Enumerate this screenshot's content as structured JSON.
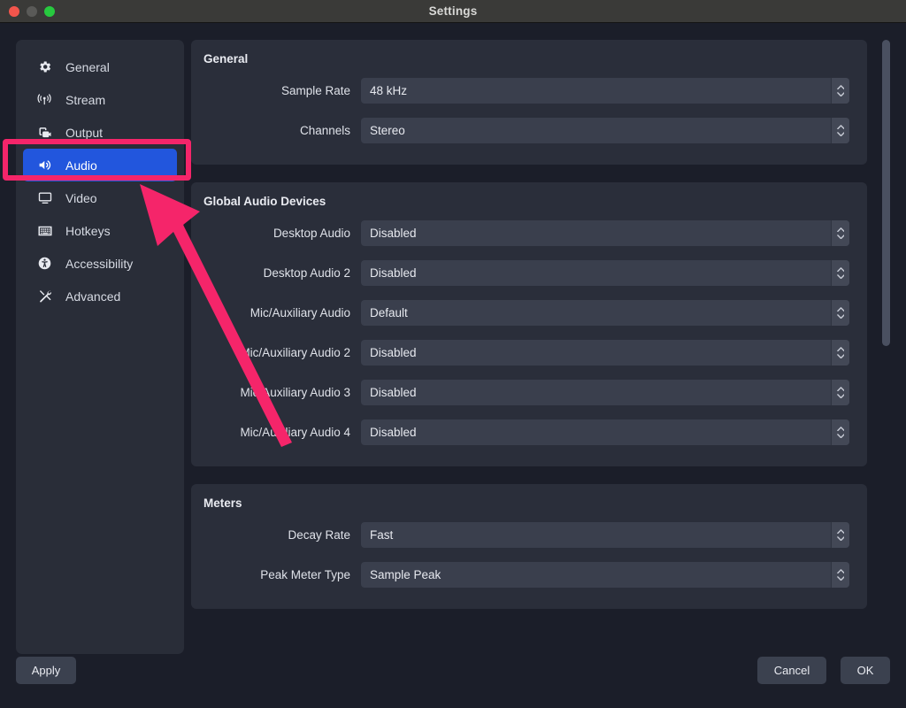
{
  "window": {
    "title": "Settings",
    "traffic_lights": [
      "close",
      "minimize",
      "maximize"
    ]
  },
  "sidebar": {
    "items": [
      {
        "label": "General",
        "icon": "gear-icon",
        "active": false
      },
      {
        "label": "Stream",
        "icon": "broadcast-icon",
        "active": false
      },
      {
        "label": "Output",
        "icon": "video-output-icon",
        "active": false
      },
      {
        "label": "Audio",
        "icon": "speaker-icon",
        "active": true
      },
      {
        "label": "Video",
        "icon": "monitor-icon",
        "active": false
      },
      {
        "label": "Hotkeys",
        "icon": "keyboard-icon",
        "active": false
      },
      {
        "label": "Accessibility",
        "icon": "accessibility-icon",
        "active": false
      },
      {
        "label": "Advanced",
        "icon": "tools-icon",
        "active": false
      }
    ]
  },
  "main": {
    "groups": [
      {
        "title": "General",
        "rows": [
          {
            "label": "Sample Rate",
            "value": "48 kHz"
          },
          {
            "label": "Channels",
            "value": "Stereo"
          }
        ]
      },
      {
        "title": "Global Audio Devices",
        "rows": [
          {
            "label": "Desktop Audio",
            "value": "Disabled"
          },
          {
            "label": "Desktop Audio 2",
            "value": "Disabled"
          },
          {
            "label": "Mic/Auxiliary Audio",
            "value": "Default"
          },
          {
            "label": "Mic/Auxiliary Audio 2",
            "value": "Disabled"
          },
          {
            "label": "Mic/Auxiliary Audio 3",
            "value": "Disabled"
          },
          {
            "label": "Mic/Auxiliary Audio 4",
            "value": "Disabled"
          }
        ]
      },
      {
        "title": "Meters",
        "rows": [
          {
            "label": "Decay Rate",
            "value": "Fast"
          },
          {
            "label": "Peak Meter Type",
            "value": "Sample Peak"
          }
        ]
      }
    ]
  },
  "footer": {
    "apply_label": "Apply",
    "cancel_label": "Cancel",
    "ok_label": "OK"
  },
  "annotation": {
    "highlight_color": "#f5256a",
    "target": "Audio"
  },
  "colors": {
    "window_bg": "#1b1e29",
    "panel_bg": "#2a2e3a",
    "sidebar_bg": "#292d38",
    "field_bg": "#3a3f4d",
    "accent_selected": "#2256dd",
    "annotation": "#f5256a"
  }
}
